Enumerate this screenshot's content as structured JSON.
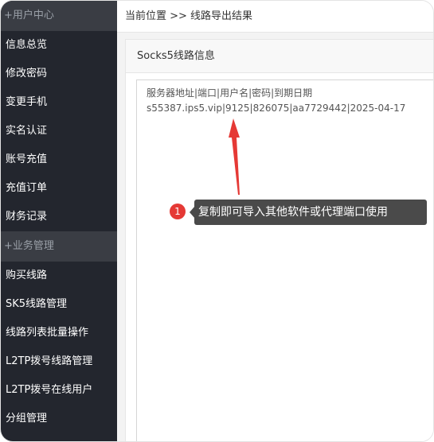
{
  "sidebar": {
    "groups": [
      {
        "title": "+用户中心",
        "items": [
          "信息总览",
          "修改密码",
          "变更手机",
          "实名认证",
          "账号充值",
          "充值订单",
          "财务记录"
        ]
      },
      {
        "title": "+业务管理",
        "items": [
          "购买线路",
          "SK5线路管理",
          "线路列表批量操作",
          "L2TP拨号线路管理",
          "L2TP拨号在线用户",
          "分组管理"
        ]
      }
    ]
  },
  "breadcrumb": "当前位置 >> 线路导出结果",
  "panel": {
    "title": "Socks5线路信息",
    "result_header": "服务器地址|端口|用户名|密码|到期日期",
    "result_line": "s55387.ips5.vip|9125|826075|aa7729442|2025-04-17"
  },
  "annotation": {
    "number": "1",
    "text": "复制即可导入其他软件或代理端口使用",
    "color": "#e53935"
  }
}
